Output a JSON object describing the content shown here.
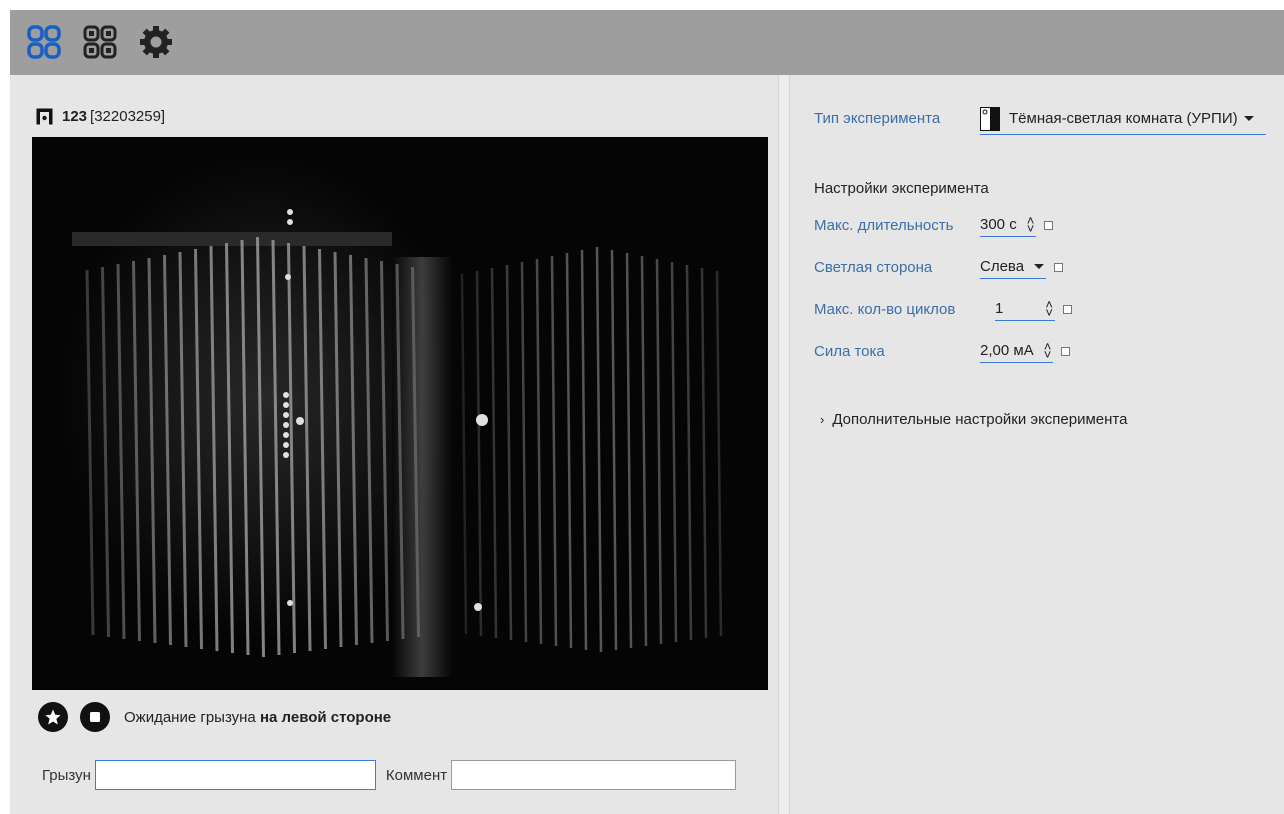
{
  "colors": {
    "toolbar_bg": "#9e9e9e",
    "panel_bg": "#e6e6e6",
    "accent": "#3a7bd5",
    "label_blue": "#3c6ea8",
    "video_bg": "#050505"
  },
  "toolbar": {
    "icons": [
      "grid-view-icon",
      "grid-view-alt-icon",
      "settings-gear-icon"
    ]
  },
  "camera": {
    "name": "123",
    "serial": "[32203259]"
  },
  "status": {
    "prefix": "Ожидание грызуна ",
    "emphasis": "на левой стороне"
  },
  "form": {
    "rodent_label": "Грызун",
    "rodent_value": "",
    "comment_label": "Коммент",
    "comment_value": ""
  },
  "experiment": {
    "type_label": "Тип эксперимента",
    "type_value": "Тёмная-светлая комната (УРПИ)",
    "settings_title": "Настройки эксперимента",
    "settings": [
      {
        "label": "Макс. длительность",
        "value": "300 с",
        "control": "spinner",
        "checked": false
      },
      {
        "label": "Светлая сторона",
        "value": "Слева",
        "control": "dropdown",
        "checked": false
      },
      {
        "label": "Макс. кол-во циклов",
        "value": "1",
        "control": "spinner",
        "checked": false
      },
      {
        "label": "Сила тока",
        "value": "2,00 мА",
        "control": "spinner",
        "checked": false
      }
    ],
    "advanced_label": "Дополнительные настройки эксперимента"
  }
}
